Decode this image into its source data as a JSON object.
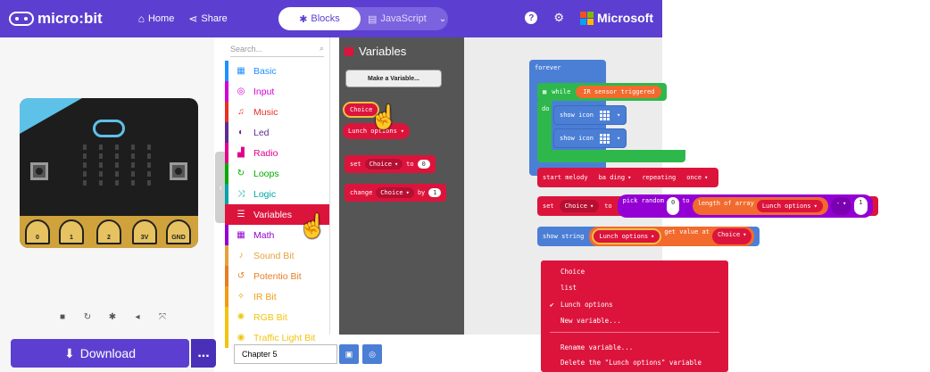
{
  "topbar": {
    "brand": "micro:bit",
    "home_label": "Home",
    "share_label": "Share",
    "blocks_label": "Blocks",
    "javascript_label": "JavaScript",
    "microsoft_label": "Microsoft"
  },
  "simulator": {
    "pins": [
      "0",
      "1",
      "2",
      "3V",
      "GND"
    ],
    "download_label": "Download",
    "more_label": "..."
  },
  "toolbox": {
    "search_placeholder": "Search...",
    "categories": [
      {
        "label": "Basic",
        "color": "#1e90ff",
        "icon": "grid-icon"
      },
      {
        "label": "Input",
        "color": "#d400d4",
        "icon": "target-icon"
      },
      {
        "label": "Music",
        "color": "#e63022",
        "icon": "headphones-icon"
      },
      {
        "label": "Led",
        "color": "#5c2d91",
        "icon": "toggle-icon"
      },
      {
        "label": "Radio",
        "color": "#e3008c",
        "icon": "signal-icon"
      },
      {
        "label": "Loops",
        "color": "#00aa00",
        "icon": "loop-icon"
      },
      {
        "label": "Logic",
        "color": "#00a4a6",
        "icon": "shuffle-icon"
      },
      {
        "label": "Variables",
        "color": "#dc143c",
        "icon": "list-icon"
      },
      {
        "label": "Math",
        "color": "#9400d3",
        "icon": "calculator-icon"
      },
      {
        "label": "Sound Bit",
        "color": "#e6a23c",
        "icon": "microphone-icon"
      },
      {
        "label": "Potentio Bit",
        "color": "#e67e22",
        "icon": "dial-icon"
      },
      {
        "label": "IR Bit",
        "color": "#f39c12",
        "icon": "ir-icon"
      },
      {
        "label": "RGB Bit",
        "color": "#f1c40f",
        "icon": "rgb-icon"
      },
      {
        "label": "Traffic Light Bit",
        "color": "#f1c40f",
        "icon": "traffic-icon"
      }
    ]
  },
  "flyout": {
    "title": "Variables",
    "make_variable": "Make a Variable...",
    "var1": "Choice",
    "var2": "Lunch options",
    "set_label": "set",
    "to_label": "to",
    "set_value": "0",
    "change_label": "change",
    "by_label": "by",
    "change_value": "1"
  },
  "footer": {
    "project_name": "Chapter 5"
  },
  "workspace": {
    "forever": "forever",
    "while": "while",
    "condition": "IR sensor triggered",
    "do": "do",
    "show_icon": "show icon",
    "start_melody": "start melody",
    "melody": "ba ding",
    "repeating": "repeating",
    "repeat_mode": "once",
    "set": "set",
    "set_var": "Choice",
    "to": "to",
    "pick_random": "pick random",
    "rand_from": "0",
    "rand_to": "to",
    "length_of_array": "length of array",
    "array_var": "Lunch options",
    "minus": "-",
    "minus_val": "1",
    "show_string": "show string",
    "str_var": "Lunch options",
    "get_value_at": "get value at",
    "index_var": "Choice"
  },
  "dropdown": {
    "items": [
      "Choice",
      "list",
      "Lunch options",
      "New variable...",
      "Rename variable...",
      "Delete the \"Lunch options\" variable"
    ],
    "checked_index": 2
  }
}
